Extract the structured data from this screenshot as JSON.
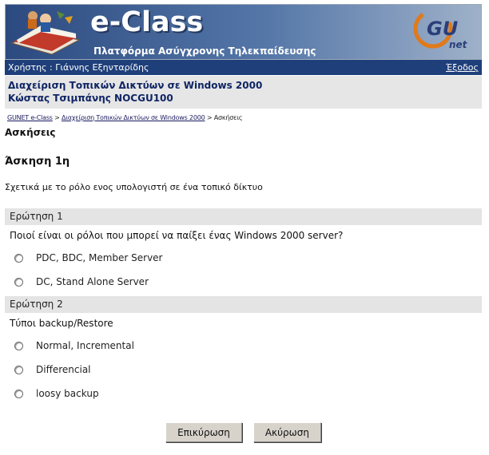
{
  "header": {
    "brand": "e-Class",
    "subtitle": "Πλατφόρμα Ασύγχρονης Τηλεκπαίδευσης",
    "partner_logo": "GUnet",
    "colors": {
      "banner": "#2c4a80",
      "userbar": "#1f3f7a",
      "course_text": "#0f2564"
    }
  },
  "userbar": {
    "user_label": "Χρήστης : Γιάννης Εξηνταρίδης",
    "logout": "Έξοδος"
  },
  "course": {
    "title": "Διαχείριση Τοπικών Δικτύων σε Windows 2000",
    "instructor": "Κώστας Τσιμπάνης NOCGU100"
  },
  "breadcrumb": {
    "home": "GUNET e-Class",
    "sep1": " > ",
    "course": "Διαχείριση Τοπικών Δικτύων σε Windows 2000",
    "sep2": " > ",
    "current": "Ασκήσεις"
  },
  "page": {
    "section_title": "Ασκήσεις",
    "exercise_title": "Άσκηση 1η",
    "exercise_description": "Σχετικά με το ρόλο ενος υπολογιστή σε ένα τοπικό δίκτυο"
  },
  "questions": [
    {
      "label": "Ερώτηση 1",
      "text": "Ποιοί είναι οι ρόλοι που μπορεί να παίξει ένας Windows 2000 server?",
      "options": [
        "PDC, BDC, Member Server",
        "DC, Stand Alone Server"
      ]
    },
    {
      "label": "Ερώτηση 2",
      "text": "Τύποι backup/Restore",
      "options": [
        "Normal, Incremental",
        "Differencial",
        "loosy backup"
      ]
    }
  ],
  "actions": {
    "submit": "Επικύρωση",
    "cancel": "Ακύρωση"
  }
}
